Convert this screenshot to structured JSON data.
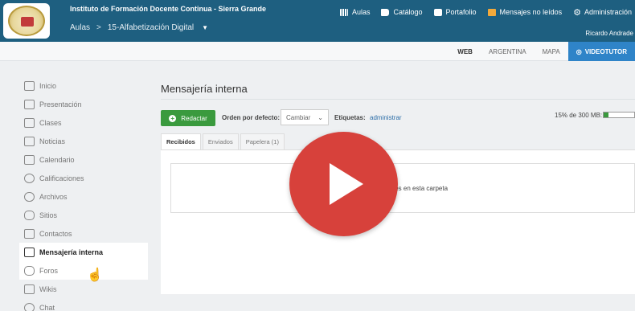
{
  "header": {
    "institution": "Instituto de Formación Docente Continua - Sierra Grande",
    "breadcrumb": [
      "Aulas",
      "15-Alfabetización Digital"
    ],
    "breadcrumb_sep": ">",
    "nav": [
      {
        "label": "Aulas",
        "icon": "institution-icon"
      },
      {
        "label": "Catálogo",
        "icon": "book-icon"
      },
      {
        "label": "Portafolio",
        "icon": "briefcase-icon"
      },
      {
        "label": "Mensajes no leídos",
        "icon": "mail-icon"
      },
      {
        "label": "Administración",
        "icon": "gear-icon"
      }
    ],
    "user": "Ricardo Andrade"
  },
  "subnav": {
    "tabs": [
      "WEB",
      "ARGENTINA",
      "MAPA",
      "VIDEOTUTOR"
    ],
    "video_prefix": "◎"
  },
  "sidebar": {
    "items": [
      {
        "label": "Inicio",
        "icon": "home-icon"
      },
      {
        "label": "Presentación",
        "icon": "presentation-icon"
      },
      {
        "label": "Clases",
        "icon": "graduation-icon"
      },
      {
        "label": "Noticias",
        "icon": "news-icon"
      },
      {
        "label": "Calendario",
        "icon": "calendar-icon"
      },
      {
        "label": "Calificaciones",
        "icon": "check-icon"
      },
      {
        "label": "Archivos",
        "icon": "cloud-icon"
      },
      {
        "label": "Sitios",
        "icon": "link-icon"
      },
      {
        "label": "Contactos",
        "icon": "contacts-icon"
      },
      {
        "label": "Mensajería interna",
        "icon": "mail-icon"
      },
      {
        "label": "Foros",
        "icon": "forum-icon"
      },
      {
        "label": "Wikis",
        "icon": "wiki-icon"
      },
      {
        "label": "Chat",
        "icon": "chat-icon"
      }
    ],
    "active": "Mensajería interna"
  },
  "main": {
    "title": "Mensajería interna",
    "compose_label": "Redactar",
    "sort_label": "Orden por defecto:",
    "sort_value": "Cambiar",
    "tags_label": "Etiquetas:",
    "tags_value": "administrar",
    "quota_text": "15% de 300 MB:",
    "quota_fraction": 0.15,
    "tabs": [
      "Recibidos",
      "Enviados",
      "Papelera (1)"
    ],
    "empty_message": "ajes en esta carpeta"
  },
  "colors": {
    "header_bg": "#1e5f80",
    "accent_green": "#3a9a3e",
    "play_red": "#d7413b",
    "video_tab": "#2f84c8"
  }
}
